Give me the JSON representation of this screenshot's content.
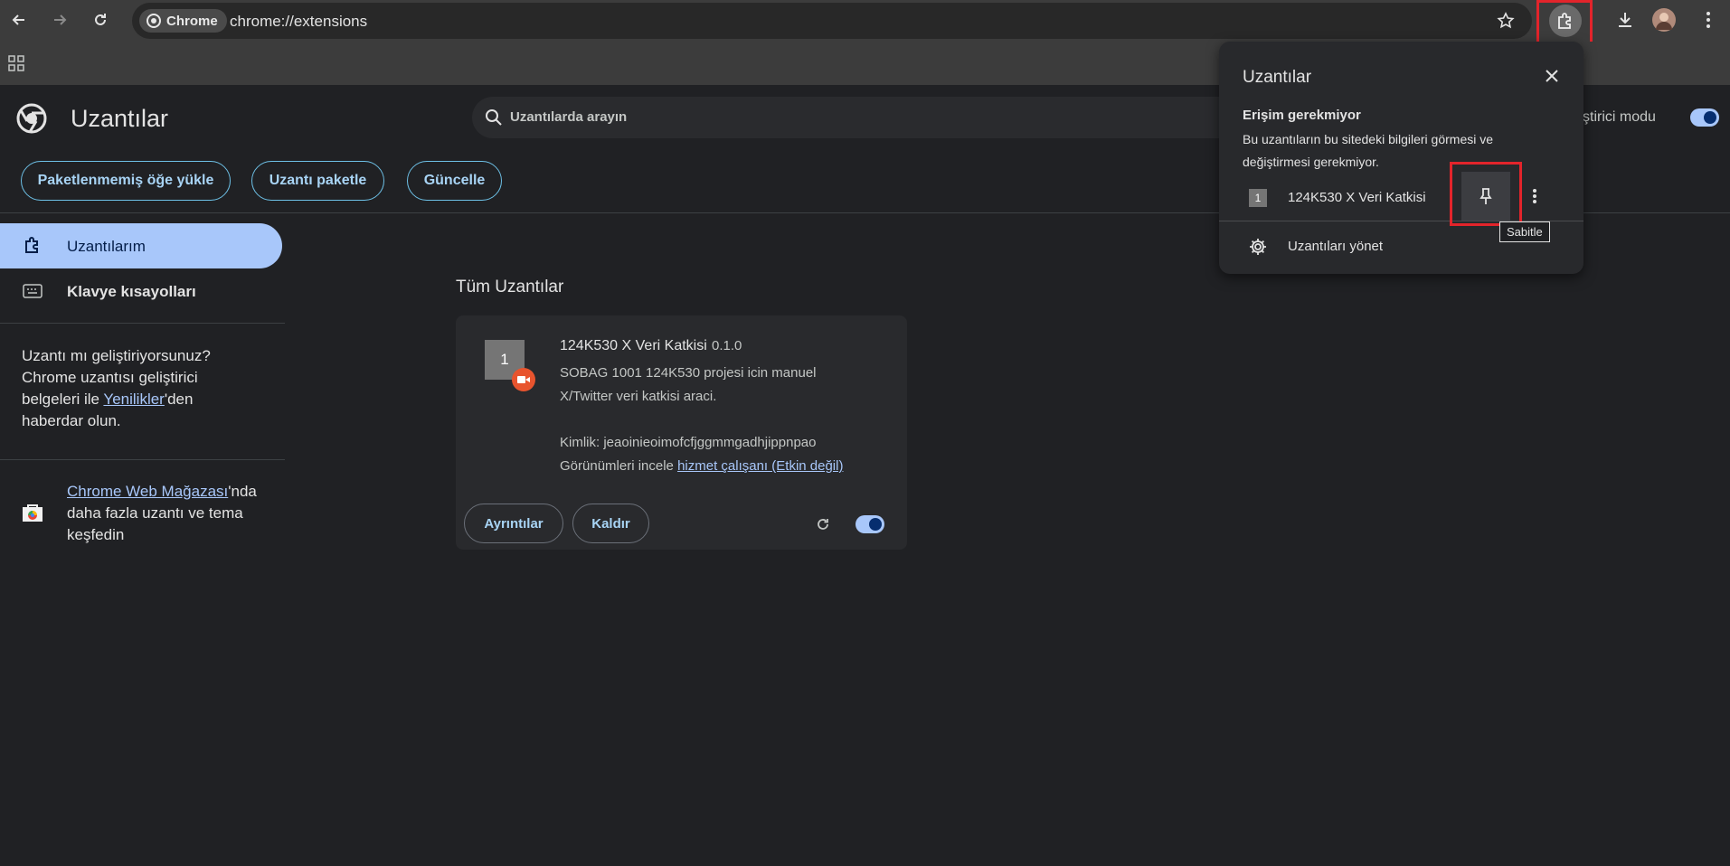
{
  "browser": {
    "chip_label": "Chrome",
    "url": "chrome://extensions"
  },
  "header": {
    "title": "Uzantılar",
    "search_placeholder": "Uzantılarda arayın",
    "dev_mode_label": "eliştirici modu"
  },
  "actions": {
    "load_unpacked": "Paketlenmemiş öğe yükle",
    "pack": "Uzantı paketle",
    "update": "Güncelle"
  },
  "sidebar": {
    "items": [
      {
        "label": "Uzantılarım",
        "icon": "puzzle-icon",
        "active": true
      },
      {
        "label": "Klavye kısayolları",
        "icon": "keyboard-icon",
        "active": false
      }
    ],
    "dev_text_1": "Uzantı mı geliştiriyorsunuz? Chrome uzantısı geliştirici belgeleri ile ",
    "dev_link": "Yenilikler",
    "dev_text_2": "'den haberdar olun.",
    "store_link": "Chrome Web Mağazası",
    "store_text": "'nda daha fazla uzantı ve tema keşfedin"
  },
  "main": {
    "section_title": "Tüm Uzantılar",
    "extension": {
      "icon_label": "1",
      "name": "124K530 X Veri Katkisi",
      "version": "0.1.0",
      "description": "SOBAG 1001 124K530 projesi icin manuel X/Twitter veri katkisi araci.",
      "id_text": "Kimlik: jeaoinieoimofcfjggmmgadhjippnpao",
      "views_label": "Görünümleri incele ",
      "views_link": "hizmet çalışanı (Etkin değil)",
      "details_btn": "Ayrıntılar",
      "remove_btn": "Kaldır",
      "enabled": true
    }
  },
  "popup": {
    "title": "Uzantılar",
    "subtitle": "Erişim gerekmiyor",
    "description": "Bu uzantıların bu sitedeki bilgileri görmesi ve değiştirmesi gerekmiyor.",
    "ext_icon_label": "1",
    "ext_name": "124K530 X Veri Katkisi",
    "manage": "Uzantıları yönet",
    "pin_tooltip": "Sabitle"
  },
  "colors": {
    "accent": "#a8c7fa",
    "highlight": "#e3242b"
  }
}
